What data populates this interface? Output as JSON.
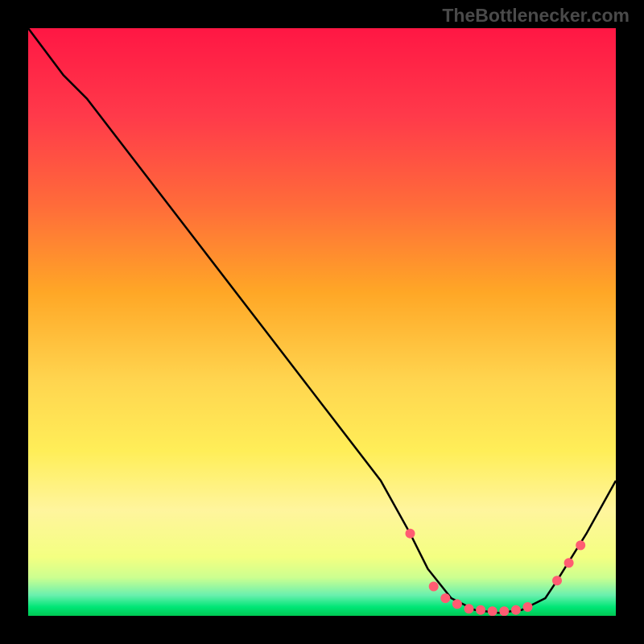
{
  "attribution": "TheBottlenecker.com",
  "chart_data": {
    "type": "line",
    "title": "",
    "xlabel": "",
    "ylabel": "",
    "xlim": [
      0,
      100
    ],
    "ylim": [
      0,
      100
    ],
    "background_gradient": {
      "stops": [
        {
          "offset": 0.0,
          "color": "#ff1744"
        },
        {
          "offset": 0.15,
          "color": "#ff3a4a"
        },
        {
          "offset": 0.3,
          "color": "#ff6b3a"
        },
        {
          "offset": 0.45,
          "color": "#ffa726"
        },
        {
          "offset": 0.6,
          "color": "#ffd54f"
        },
        {
          "offset": 0.72,
          "color": "#ffee58"
        },
        {
          "offset": 0.82,
          "color": "#fff59d"
        },
        {
          "offset": 0.9,
          "color": "#f4ff81"
        },
        {
          "offset": 0.935,
          "color": "#ccff90"
        },
        {
          "offset": 0.965,
          "color": "#69f0ae"
        },
        {
          "offset": 0.985,
          "color": "#00e676"
        },
        {
          "offset": 1.0,
          "color": "#00c853"
        }
      ]
    },
    "series": [
      {
        "name": "bottleneck-curve",
        "x": [
          0,
          6,
          10,
          20,
          30,
          40,
          50,
          60,
          65,
          68,
          72,
          76,
          80,
          84,
          88,
          90,
          95,
          100
        ],
        "y": [
          100,
          92,
          88,
          75,
          62,
          49,
          36,
          23,
          14,
          8,
          3,
          1,
          0.5,
          1,
          3,
          6,
          14,
          23
        ],
        "color": "#000000"
      }
    ],
    "markers": {
      "comment": "red dots near the valley of the curve",
      "x": [
        65,
        69,
        71,
        73,
        75,
        77,
        79,
        81,
        83,
        85,
        90,
        92,
        94
      ],
      "y": [
        14,
        5,
        3,
        2,
        1.2,
        1,
        0.8,
        0.8,
        1,
        1.5,
        6,
        9,
        12
      ],
      "color": "#ff5c72",
      "radius": 6
    }
  }
}
